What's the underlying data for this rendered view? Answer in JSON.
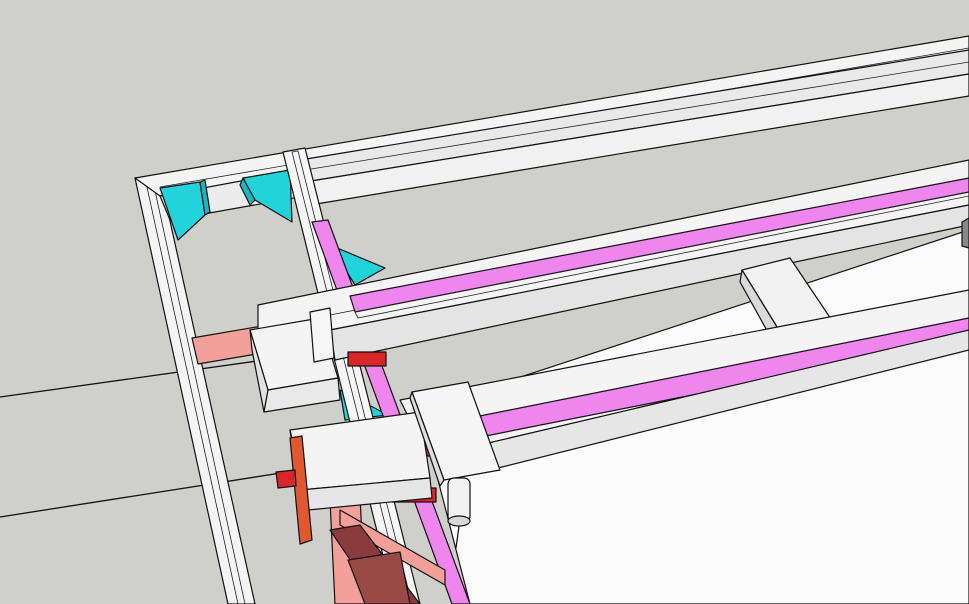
{
  "scene": {
    "kind": "3d-model-viewport",
    "colors": {
      "background": "#cfcfcb",
      "frame_white": "#f4f4f4",
      "frame_shade": "#dcdcdc",
      "cyan_bracket": "#22d3dc",
      "cyan_dark": "#19b7c2",
      "magenta_rail": "#ee86ee",
      "magenta_dark": "#c95fc9",
      "salmon_beam": "#f3a09a",
      "red_block": "#d9262a",
      "orange_plate": "#e0582f",
      "brown_post": "#8a3c3c",
      "bed_white": "#fbfbfb"
    },
    "parts": [
      "outer-frame",
      "rear-rail",
      "cyan-corner-brackets",
      "magenta-linear-rails",
      "y-axis-gantry",
      "x-axis-carriage",
      "spindle-tool",
      "salmon-crossbeam",
      "red-bearing-blocks",
      "orange-end-plate",
      "brown-support-post",
      "work-bed"
    ]
  }
}
